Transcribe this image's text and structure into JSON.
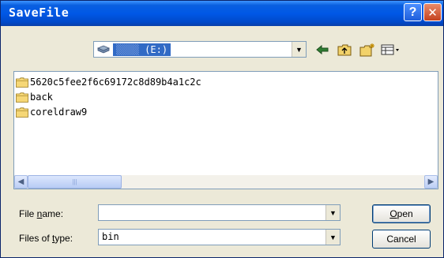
{
  "window": {
    "title": "SaveFile",
    "help_glyph": "?",
    "close_glyph": "✕"
  },
  "toolbar": {
    "lookin_visible": "(E:)",
    "lookin_obscured": "▒▒▒▒",
    "back_icon": "back-arrow-icon",
    "up_icon": "up-folder-icon",
    "newfolder_icon": "new-folder-icon",
    "views_icon": "views-menu-icon"
  },
  "files": [
    {
      "name": "5620c5fee2f6c69172c8d89b4a1c2c",
      "icon": "folder-icon"
    },
    {
      "name": "back",
      "icon": "folder-icon"
    },
    {
      "name": "coreldraw9",
      "icon": "folder-icon"
    }
  ],
  "filename": {
    "label_pre": "File ",
    "label_access": "n",
    "label_post": "ame:",
    "value": ""
  },
  "filetype": {
    "label_pre": "Files of ",
    "label_access": "t",
    "label_post": "ype:",
    "value": "bin"
  },
  "buttons": {
    "open_access": "O",
    "open_rest": "pen",
    "cancel": "Cancel"
  },
  "colors": {
    "title_bar": "#0058E6",
    "selection": "#316AC5",
    "window_bg": "#ECE9D8"
  }
}
